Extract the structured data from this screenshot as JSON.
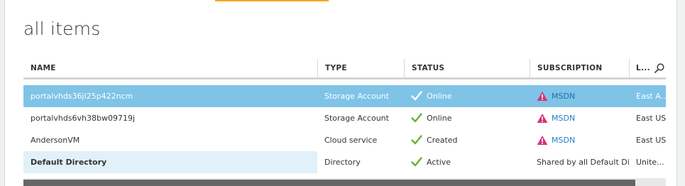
{
  "page_title": "all items",
  "columns": [
    "NAME",
    "TYPE",
    "STATUS",
    "SUBSCRIPTION",
    "L..."
  ],
  "rows": [
    {
      "name": "portalvhds36jl25p422ncm",
      "type": "Storage Account",
      "status": "Online",
      "subscription": "MSDN",
      "location": "East A..."
    },
    {
      "name": "portalvhds6vh38bw09719j",
      "type": "Storage Account",
      "status": "Online",
      "subscription": "MSDN",
      "location": "East US"
    },
    {
      "name": "AndersonVM",
      "type": "Cloud service",
      "status": "Created",
      "subscription": "MSDN",
      "location": "East US"
    },
    {
      "name": "Default Directory",
      "type": "Directory",
      "status": "Active",
      "subscription": "Shared by all Default Dir...",
      "location": "Unite..."
    }
  ],
  "colors": {
    "selected_row": "#7fc3e7",
    "check": "#6ab033",
    "warning": "#d6337a",
    "link": "#1f7fc5"
  }
}
